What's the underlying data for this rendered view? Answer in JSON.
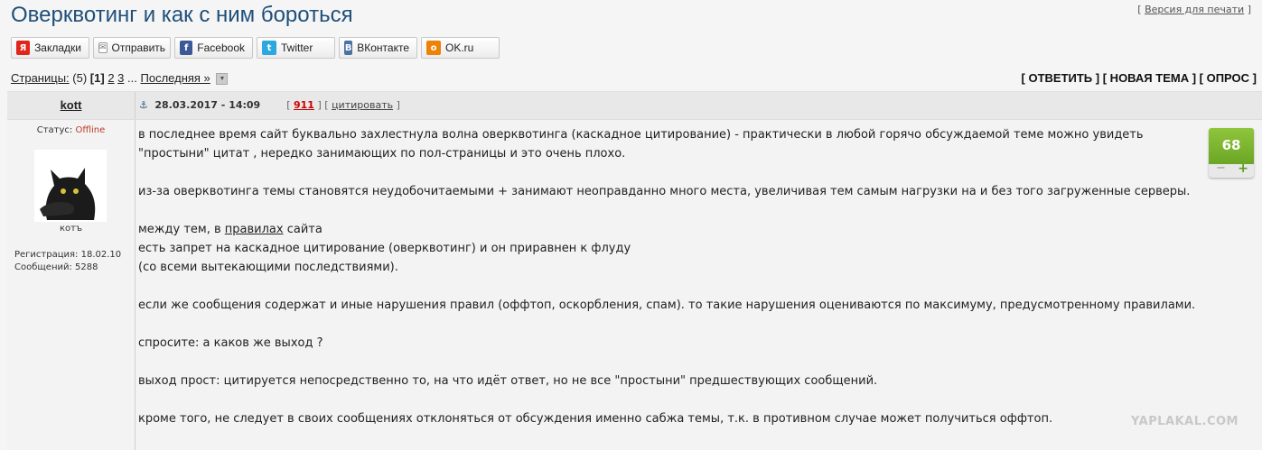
{
  "topic": {
    "title": "Оверквотинг и как с ним бороться",
    "print_version": "Версия для печати",
    "print_open": "[ ",
    "print_close": " ]"
  },
  "share": [
    {
      "label": "Закладки",
      "icon": "yandex-icon",
      "glyph": "Я",
      "color": "#e0261b"
    },
    {
      "label": "Отправить",
      "icon": "mail-icon",
      "glyph": "✉",
      "color": "#888888"
    },
    {
      "label": "Facebook",
      "icon": "facebook-icon",
      "glyph": "f",
      "color": "#3b5998"
    },
    {
      "label": "Twitter",
      "icon": "twitter-icon",
      "glyph": "t",
      "color": "#2ca7e0"
    },
    {
      "label": "ВКонтакте",
      "icon": "vk-icon",
      "glyph": "В",
      "color": "#4b72a3"
    },
    {
      "label": "OK.ru",
      "icon": "odnoklassniki-icon",
      "glyph": "o",
      "color": "#ee8208"
    }
  ],
  "pager": {
    "label": "Страницы:",
    "count": "(5)",
    "current": "[1]",
    "page2": "2",
    "page3": "3",
    "ellipsis": "...",
    "last": "Последняя »"
  },
  "actions": {
    "reply": "[ ОТВЕТИТЬ ]",
    "new_topic": "[ НОВАЯ ТЕМА ]",
    "poll": "[ ОПРОС ]"
  },
  "post": {
    "author": "kott",
    "date": "28.03.2017 - 14:09",
    "number": "911",
    "quote": "цитировать",
    "bracket_open": "[",
    "bracket_close": "]",
    "status_label": "Статус:",
    "status_value": "Offline",
    "nickname": "котъ",
    "registration": "Регистрация: 18.02.10",
    "messages": "Сообщений: 5288",
    "rating": "68",
    "rating_minus": "−",
    "rating_plus": "+",
    "paragraphs": {
      "p1a": "в последнее время сайт буквально захлестнула волна оверквотинга (каскадное цитирование) - практически в любой горячо обсуждаемой теме можно увидеть",
      "p1b": "\"простыни\" цитат , нередко занимающих по пол-страницы и это очень плохо.",
      "p2": "из-за оверквотинга темы становятся неудобочитаемыми + занимают неоправданно много места, увеличивая тем самым нагрузки на и без того загруженные серверы.",
      "p3a": "между тем, в ",
      "p3link": "правилах",
      "p3b": " сайта",
      "p3c": "есть запрет на каскадное цитирование (оверквотинг) и он приравнен к флуду",
      "p3d": "(со всеми вытекающими последствиями).",
      "p4": "если же сообщения содержат и иные нарушения правил (оффтоп, оскорбления, спам). то такие нарушения оцениваются по максимуму, предусмотренному правилами.",
      "p5": "спросите: а каков же выход ?",
      "p6": "выход прост: цитируется непосредственно то, на что идёт ответ, но не все \"простыни\" предшествующих сообщений.",
      "p7": "кроме того, не следует в своих сообщениях отклоняться от обсуждения именно сабжа темы, т.к. в противном случае может получиться оффтоп."
    }
  },
  "watermark": "YAPLAKAL.COM"
}
